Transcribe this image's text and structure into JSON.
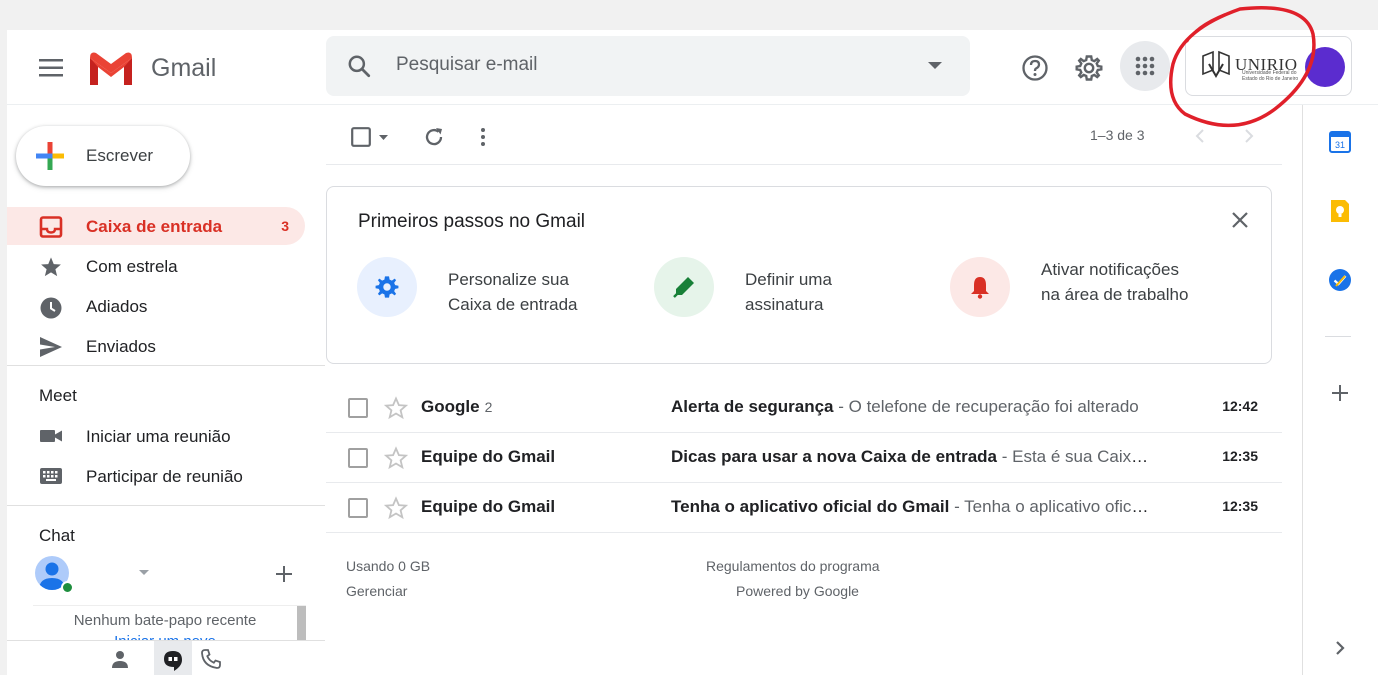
{
  "app": {
    "name": "Gmail"
  },
  "header": {
    "search_placeholder": "Pesquisar e-mail",
    "account_logo_text": "UNIRIO",
    "account_logo_subtext": "Universidade Federal do Estado do Rio de Janeiro"
  },
  "compose": {
    "label": "Escrever"
  },
  "nav": [
    {
      "label": "Caixa de entrada",
      "count": "3",
      "icon": "inbox-icon",
      "active": true
    },
    {
      "label": "Com estrela",
      "icon": "star-icon"
    },
    {
      "label": "Adiados",
      "icon": "clock-icon"
    },
    {
      "label": "Enviados",
      "icon": "send-icon"
    }
  ],
  "meet": {
    "title": "Meet",
    "items": [
      {
        "label": "Iniciar uma reunião",
        "icon": "video-camera-icon"
      },
      {
        "label": "Participar de reunião",
        "icon": "keyboard-icon"
      }
    ]
  },
  "chat": {
    "title": "Chat",
    "empty_text": "Nenhum bate-papo recente",
    "start_link": "Iniciar um novo"
  },
  "toolbar": {
    "pager": "1–3 de 3"
  },
  "welcome": {
    "title": "Primeiros passos no Gmail",
    "steps": [
      {
        "text": "Personalize sua Caixa de entrada",
        "icon": "gear-icon",
        "color": "#1a73e8",
        "bg": "#e8f0fe"
      },
      {
        "text": "Definir uma assinatura",
        "icon": "pen-icon",
        "color": "#188038",
        "bg": "#e6f4ea"
      },
      {
        "text": "Ativar notificações na área de trabalho",
        "icon": "bell-icon",
        "color": "#d93025",
        "bg": "#fce8e6"
      }
    ]
  },
  "emails": [
    {
      "sender": "Google",
      "count": "2",
      "subject": "Alerta de segurança",
      "snippet": " - O telefone de recuperação foi alterado",
      "time": "12:42"
    },
    {
      "sender": "Equipe do Gmail",
      "count": "",
      "subject": "Dicas para usar a nova Caixa de entrada",
      "snippet": " - Esta é sua Caixa de entrada",
      "time": "12:35"
    },
    {
      "sender": "Equipe do Gmail",
      "count": "",
      "subject": "Tenha o aplicativo oficial do Gmail",
      "snippet": " - Tenha o aplicativo oficial do Gmail",
      "time": "12:35"
    }
  ],
  "footer": {
    "storage": "Usando 0 GB",
    "manage": "Gerenciar",
    "policies": "Regulamentos do programa",
    "powered": "Powered by Google"
  },
  "right_panel": {
    "calendar_day": "31"
  },
  "colors": {
    "accent_red": "#d93025",
    "active_bg": "#fce8e6",
    "annotation": "#e0202a",
    "avatar": "#5b2ccf"
  }
}
